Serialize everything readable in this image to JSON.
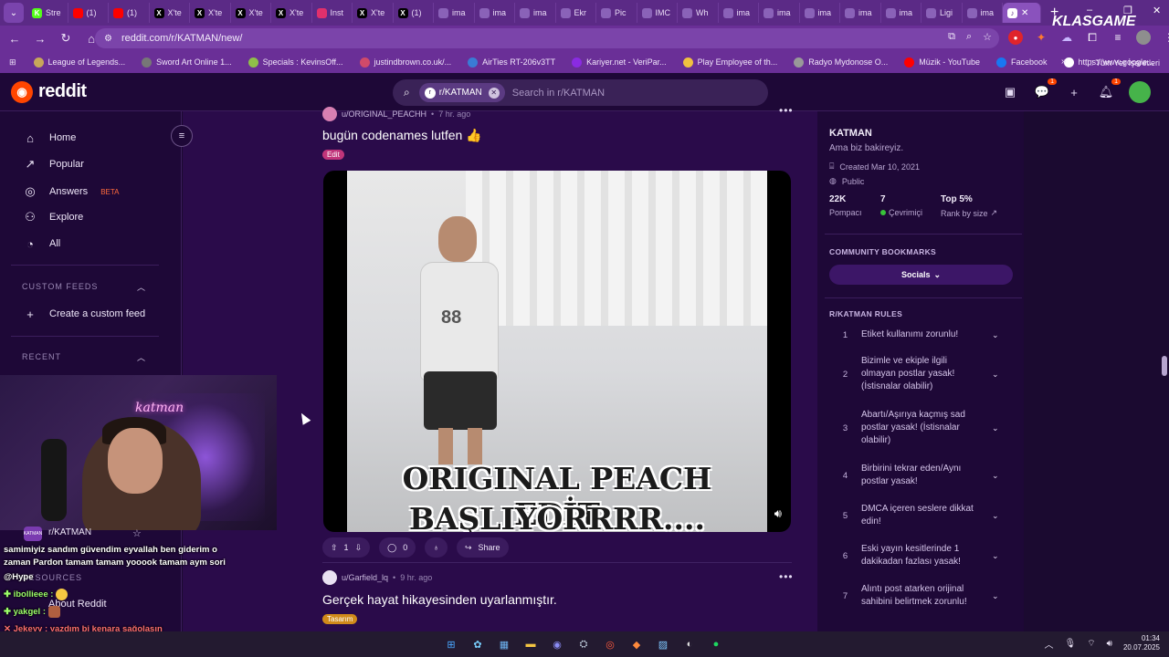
{
  "browser": {
    "tabs": [
      {
        "label": "Stre",
        "icon": "kick-icon",
        "color": "#53fc18"
      },
      {
        "label": "(1)",
        "icon": "youtube-icon",
        "color": "#ff0000"
      },
      {
        "label": "(1)",
        "icon": "youtube-icon",
        "color": "#ff0000"
      },
      {
        "label": "X'te",
        "icon": "x-icon",
        "color": "#000000"
      },
      {
        "label": "X'te",
        "icon": "x-icon",
        "color": "#000000"
      },
      {
        "label": "X'te",
        "icon": "x-icon",
        "color": "#000000"
      },
      {
        "label": "X'te",
        "icon": "x-icon",
        "color": "#000000"
      },
      {
        "label": "Inst",
        "icon": "instagram-icon",
        "color": "#e1306c"
      },
      {
        "label": "X'te",
        "icon": "x-icon",
        "color": "#000000"
      },
      {
        "label": "(1)",
        "icon": "x-icon",
        "color": "#000000"
      },
      {
        "label": "ima",
        "icon": "globe-icon",
        "color": "#8a62b8"
      },
      {
        "label": "ima",
        "icon": "globe-icon",
        "color": "#8a62b8"
      },
      {
        "label": "ima",
        "icon": "globe-icon",
        "color": "#8a62b8"
      },
      {
        "label": "Ekr",
        "icon": "globe-icon",
        "color": "#8a62b8"
      },
      {
        "label": "Pic",
        "icon": "globe-icon",
        "color": "#8a62b8"
      },
      {
        "label": "IMC",
        "icon": "globe-icon",
        "color": "#8a62b8"
      },
      {
        "label": "Wh",
        "icon": "globe-icon",
        "color": "#8a62b8"
      },
      {
        "label": "ima",
        "icon": "globe-icon",
        "color": "#8a62b8"
      },
      {
        "label": "ima",
        "icon": "globe-icon",
        "color": "#8a62b8"
      },
      {
        "label": "ima",
        "icon": "globe-icon",
        "color": "#8a62b8"
      },
      {
        "label": "ima",
        "icon": "globe-icon",
        "color": "#8a62b8"
      },
      {
        "label": "ima",
        "icon": "globe-icon",
        "color": "#8a62b8"
      },
      {
        "label": "Ligi",
        "icon": "pen-icon",
        "color": "#8a62b8"
      },
      {
        "label": "ima",
        "icon": "globe-icon",
        "color": "#8a62b8"
      }
    ],
    "url": "reddit.com/r/KATMAN/new/",
    "overlay_brand": "KLASGAME",
    "bookmarks": [
      {
        "label": "League of Legends...",
        "color": "#c7a75a"
      },
      {
        "label": "Sword Art Online 1...",
        "color": "#777777"
      },
      {
        "label": "Specials : KevinsOff...",
        "color": "#8fbf4a"
      },
      {
        "label": "justindbrown.co.uk/...",
        "color": "#d04a6a"
      },
      {
        "label": "AirTies RT-206v3TT",
        "color": "#3a7bd5"
      },
      {
        "label": "Kariyer.net - VeriPar...",
        "color": "#8a2be2"
      },
      {
        "label": "Play Employee of th...",
        "color": "#f0c040"
      },
      {
        "label": "Radyo Mydonose O...",
        "color": "#999999"
      },
      {
        "label": "Müzik - YouTube",
        "color": "#ff0000"
      },
      {
        "label": "Facebook",
        "color": "#1877f2"
      },
      {
        "label": "https://www.google...",
        "color": "#ffffff"
      }
    ],
    "all_bookmarks": "Tüm Yer İşaretleri"
  },
  "reddit": {
    "logo_text": "reddit",
    "search_chip": "r/KATMAN",
    "search_placeholder": "Search in r/KATMAN",
    "notif_count": "1",
    "chat_count": "1"
  },
  "sidebar": {
    "items": [
      {
        "label": "Home",
        "icon": "home-icon"
      },
      {
        "label": "Popular",
        "icon": "popular-icon"
      },
      {
        "label": "Answers",
        "icon": "answers-icon",
        "badge": "BETA"
      },
      {
        "label": "Explore",
        "icon": "explore-icon"
      },
      {
        "label": "All",
        "icon": "all-icon"
      }
    ],
    "custom_feeds_head": "CUSTOM FEEDS",
    "create_feed": "Create a custom feed",
    "recent_head": "RECENT",
    "recent_item": "r/KATMAN",
    "resources_head": "RESOURCES",
    "about": "About Reddit"
  },
  "posts": [
    {
      "author": "u/ORIGINAL_PEACHH",
      "time": "7 hr. ago",
      "title": "bugün codenames lutfen 👍",
      "flair": "Edit",
      "flair_color": "#c0357a",
      "caption_lines": [
        "ORIGINAL PEACH EDİT",
        "BAŞLIYORRRR...."
      ],
      "jersey": "88",
      "upvotes": "1",
      "comments": "0",
      "share": "Share"
    },
    {
      "author": "u/Garfield_lq",
      "time": "9 hr. ago",
      "title": "Gerçek hayat hikayesinden uyarlanmıştır.",
      "flair": "Tasarım",
      "flair_color": "#d08a1a"
    }
  ],
  "community": {
    "name": "KATMAN",
    "description": "Ama biz bakireyiz.",
    "created": "Created Mar 10, 2021",
    "visibility": "Public",
    "members": "22K",
    "members_label": "Pompacı",
    "online": "7",
    "online_label": "Çevrimiçi",
    "rank": "Top 5%",
    "rank_label": "Rank by size",
    "bookmarks_head": "COMMUNITY BOOKMARKS",
    "socials": "Socials",
    "rules_head": "R/KATMAN RULES",
    "rules": [
      {
        "n": "1",
        "text": "Etiket kullanımı zorunlu!"
      },
      {
        "n": "2",
        "text": "Bizimle ve ekiple ilgili olmayan postlar yasak! (İstisnalar olabilir)"
      },
      {
        "n": "3",
        "text": "Abartı/Aşırıya kaçmış sad postlar yasak! (İstisnalar olabilir)"
      },
      {
        "n": "4",
        "text": "Birbirini tekrar eden/Aynı postlar yasak!"
      },
      {
        "n": "5",
        "text": "DMCA içeren seslere dikkat edin!"
      },
      {
        "n": "6",
        "text": "Eski yayın kesitlerinde 1 dakikadan fazlası yasak!"
      },
      {
        "n": "7",
        "text": "Alıntı post atarken orijinal sahibini belirtmek zorunlu!"
      }
    ]
  },
  "stream": {
    "neon_sign": "katman",
    "chat": [
      {
        "text": "samimiyiz sandım güvendim eyvallah ben giderim o"
      },
      {
        "text": "zaman Pardon tamam tamam yooook tamam aym sori"
      },
      {
        "text": "@Hype"
      },
      {
        "text": "ibollieee :"
      },
      {
        "text": "yakgel :"
      },
      {
        "text": "Jekeyy : yazdım bi kenara sağolasın"
      }
    ]
  },
  "taskbar": {
    "time": "01:34",
    "date": "20.07.2025"
  }
}
